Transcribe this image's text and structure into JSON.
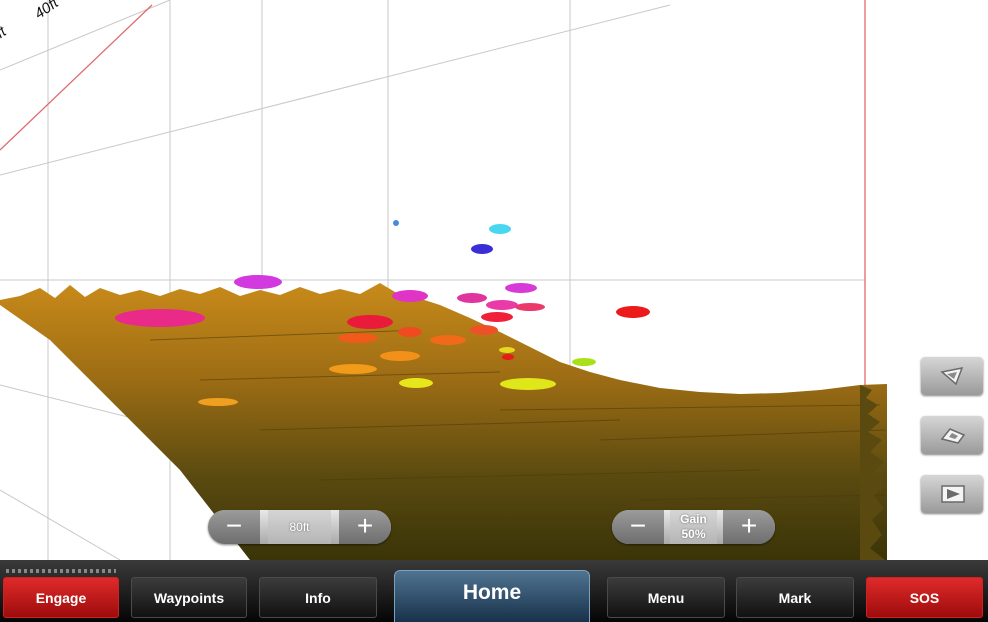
{
  "axis_labels": {
    "depth_tick": "40ft",
    "partial_tick": "ft"
  },
  "range_control": {
    "minus": "−",
    "value": "80ft",
    "plus": "+"
  },
  "gain_control": {
    "minus": "−",
    "label": "Gain",
    "value": "50%",
    "plus": "+"
  },
  "side_buttons": [
    {
      "icon": "view-angle-forward-icon"
    },
    {
      "icon": "view-angle-side-icon"
    },
    {
      "icon": "view-angle-flat-icon"
    }
  ],
  "nav": {
    "engage": "Engage",
    "waypoints": "Waypoints",
    "info": "Info",
    "home": "Home",
    "menu": "Menu",
    "mark": "Mark",
    "sos": "SOS"
  },
  "colors": {
    "alert_red": "#d11a1a",
    "home_blue": "#2d5170",
    "bottom_terrain": "#8a6418"
  }
}
